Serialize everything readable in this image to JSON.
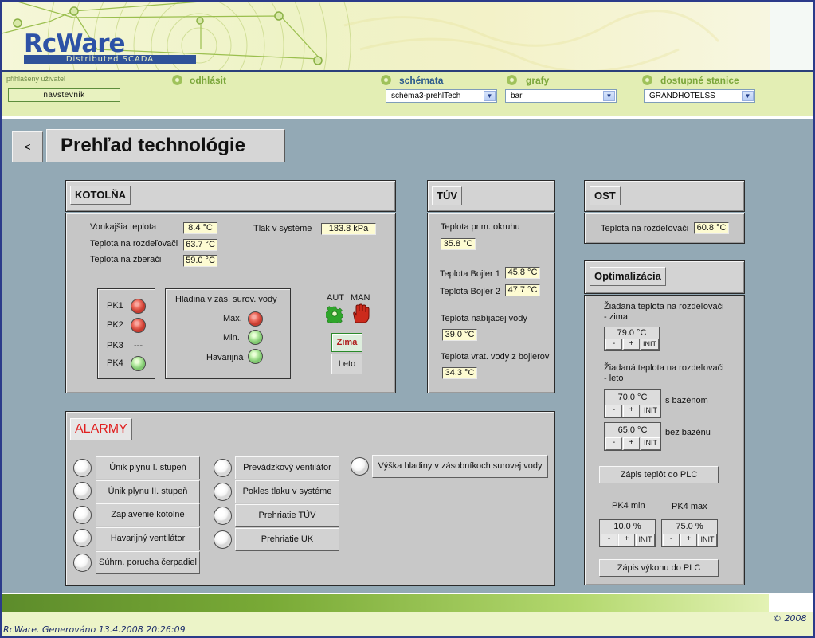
{
  "brand": {
    "logo": "RcWare",
    "tagline": "Distributed SCADA"
  },
  "nav": {
    "user_label": "přihlášený uživatel",
    "user_value": "navstevnik",
    "logout": "odhlásit",
    "schemata_label": "schémata",
    "schemata_value": "schéma3-prehlTech",
    "grafy_label": "grafy",
    "grafy_value": "bar",
    "stations_label": "dostupné stanice",
    "stations_value": "GRANDHOTELSS"
  },
  "page": {
    "back": "<",
    "title": "Prehľad technológie"
  },
  "kotolna": {
    "title": "KOTOLŇA",
    "outdoor_label": "Vonkajšia teplota",
    "outdoor_value": "8.4 °C",
    "distributor_label": "Teplota na rozdeľovači",
    "distributor_value": "63.7 °C",
    "collector_label": "Teplota na zberači",
    "collector_value": "59.0 °C",
    "pressure_label": "Tlak v systéme",
    "pressure_value": "183.8 kPa",
    "pk1": "PK1",
    "pk2": "PK2",
    "pk3": "PK3",
    "pk3_value": "---",
    "pk4": "PK4",
    "level_title": "Hladina v zás. surov. vody",
    "level_max": "Max.",
    "level_min": "Min.",
    "level_emergency": "Havarijná",
    "aut": "AUT",
    "man": "MAN",
    "zima": "Zima",
    "leto": "Leto"
  },
  "tuv": {
    "title": "TÚV",
    "prim_label": "Teplota prim. okruhu",
    "prim_value": "35.8 °C",
    "boiler1_label": "Teplota Bojler 1",
    "boiler1_value": "45.8 °C",
    "boiler2_label": "Teplota Bojler 2",
    "boiler2_value": "47.7 °C",
    "charge_label": "Teplota nabíjacej vody",
    "charge_value": "39.0 °C",
    "return_label": "Teplota vrat. vody z bojlerov",
    "return_value": "34.3 °C"
  },
  "ost": {
    "title": "OST",
    "distributor_label": "Teplota na rozdeľovači",
    "distributor_value": "60.8 °C"
  },
  "optim": {
    "title": "Optimalizácia",
    "winter_label_1": "Žiadaná teplota na rozdeľovači",
    "winter_label_2": "- zima",
    "winter_value": "79.0 °C",
    "summer_label_1": "Žiadaná teplota na rozdeľovači",
    "summer_label_2": "- leto",
    "pool_value": "70.0 °C",
    "pool_label": "s bazénom",
    "nopool_value": "65.0 °C",
    "nopool_label": "bez bazénu",
    "minus": "-",
    "plus": "+",
    "init": "INIT",
    "write_temps": "Zápis teplôt do PLC",
    "pk4min_label": "PK4 min",
    "pk4min_value": "10.0 %",
    "pk4max_label": "PK4 max",
    "pk4max_value": "75.0 %",
    "write_power": "Zápis výkonu do PLC"
  },
  "alarms": {
    "title": "ALARMY",
    "items": [
      "Únik plynu I. stupeň",
      "Únik plynu II. stupeň",
      "Zaplavenie kotolne",
      "Havarijný ventilátor",
      "Súhrn. porucha čerpadiel",
      "Prevádzkový ventilátor",
      "Pokles tlaku v systéme",
      "Prehriatie TÚV",
      "Prehriatie ÚK",
      "Výška hladiny v zásobníkoch surovej vody"
    ]
  },
  "footer": {
    "generated": "RcWare. Generováno 13.4.2008 20:26:09",
    "copyright": "© 2008"
  },
  "colors": {
    "frame": "#2b3b8a",
    "main_bg": "#93a9b5",
    "nav_bg": "#e3eeb4",
    "alarm_title": "#e02020",
    "value_bg": "#fdfbd2"
  }
}
